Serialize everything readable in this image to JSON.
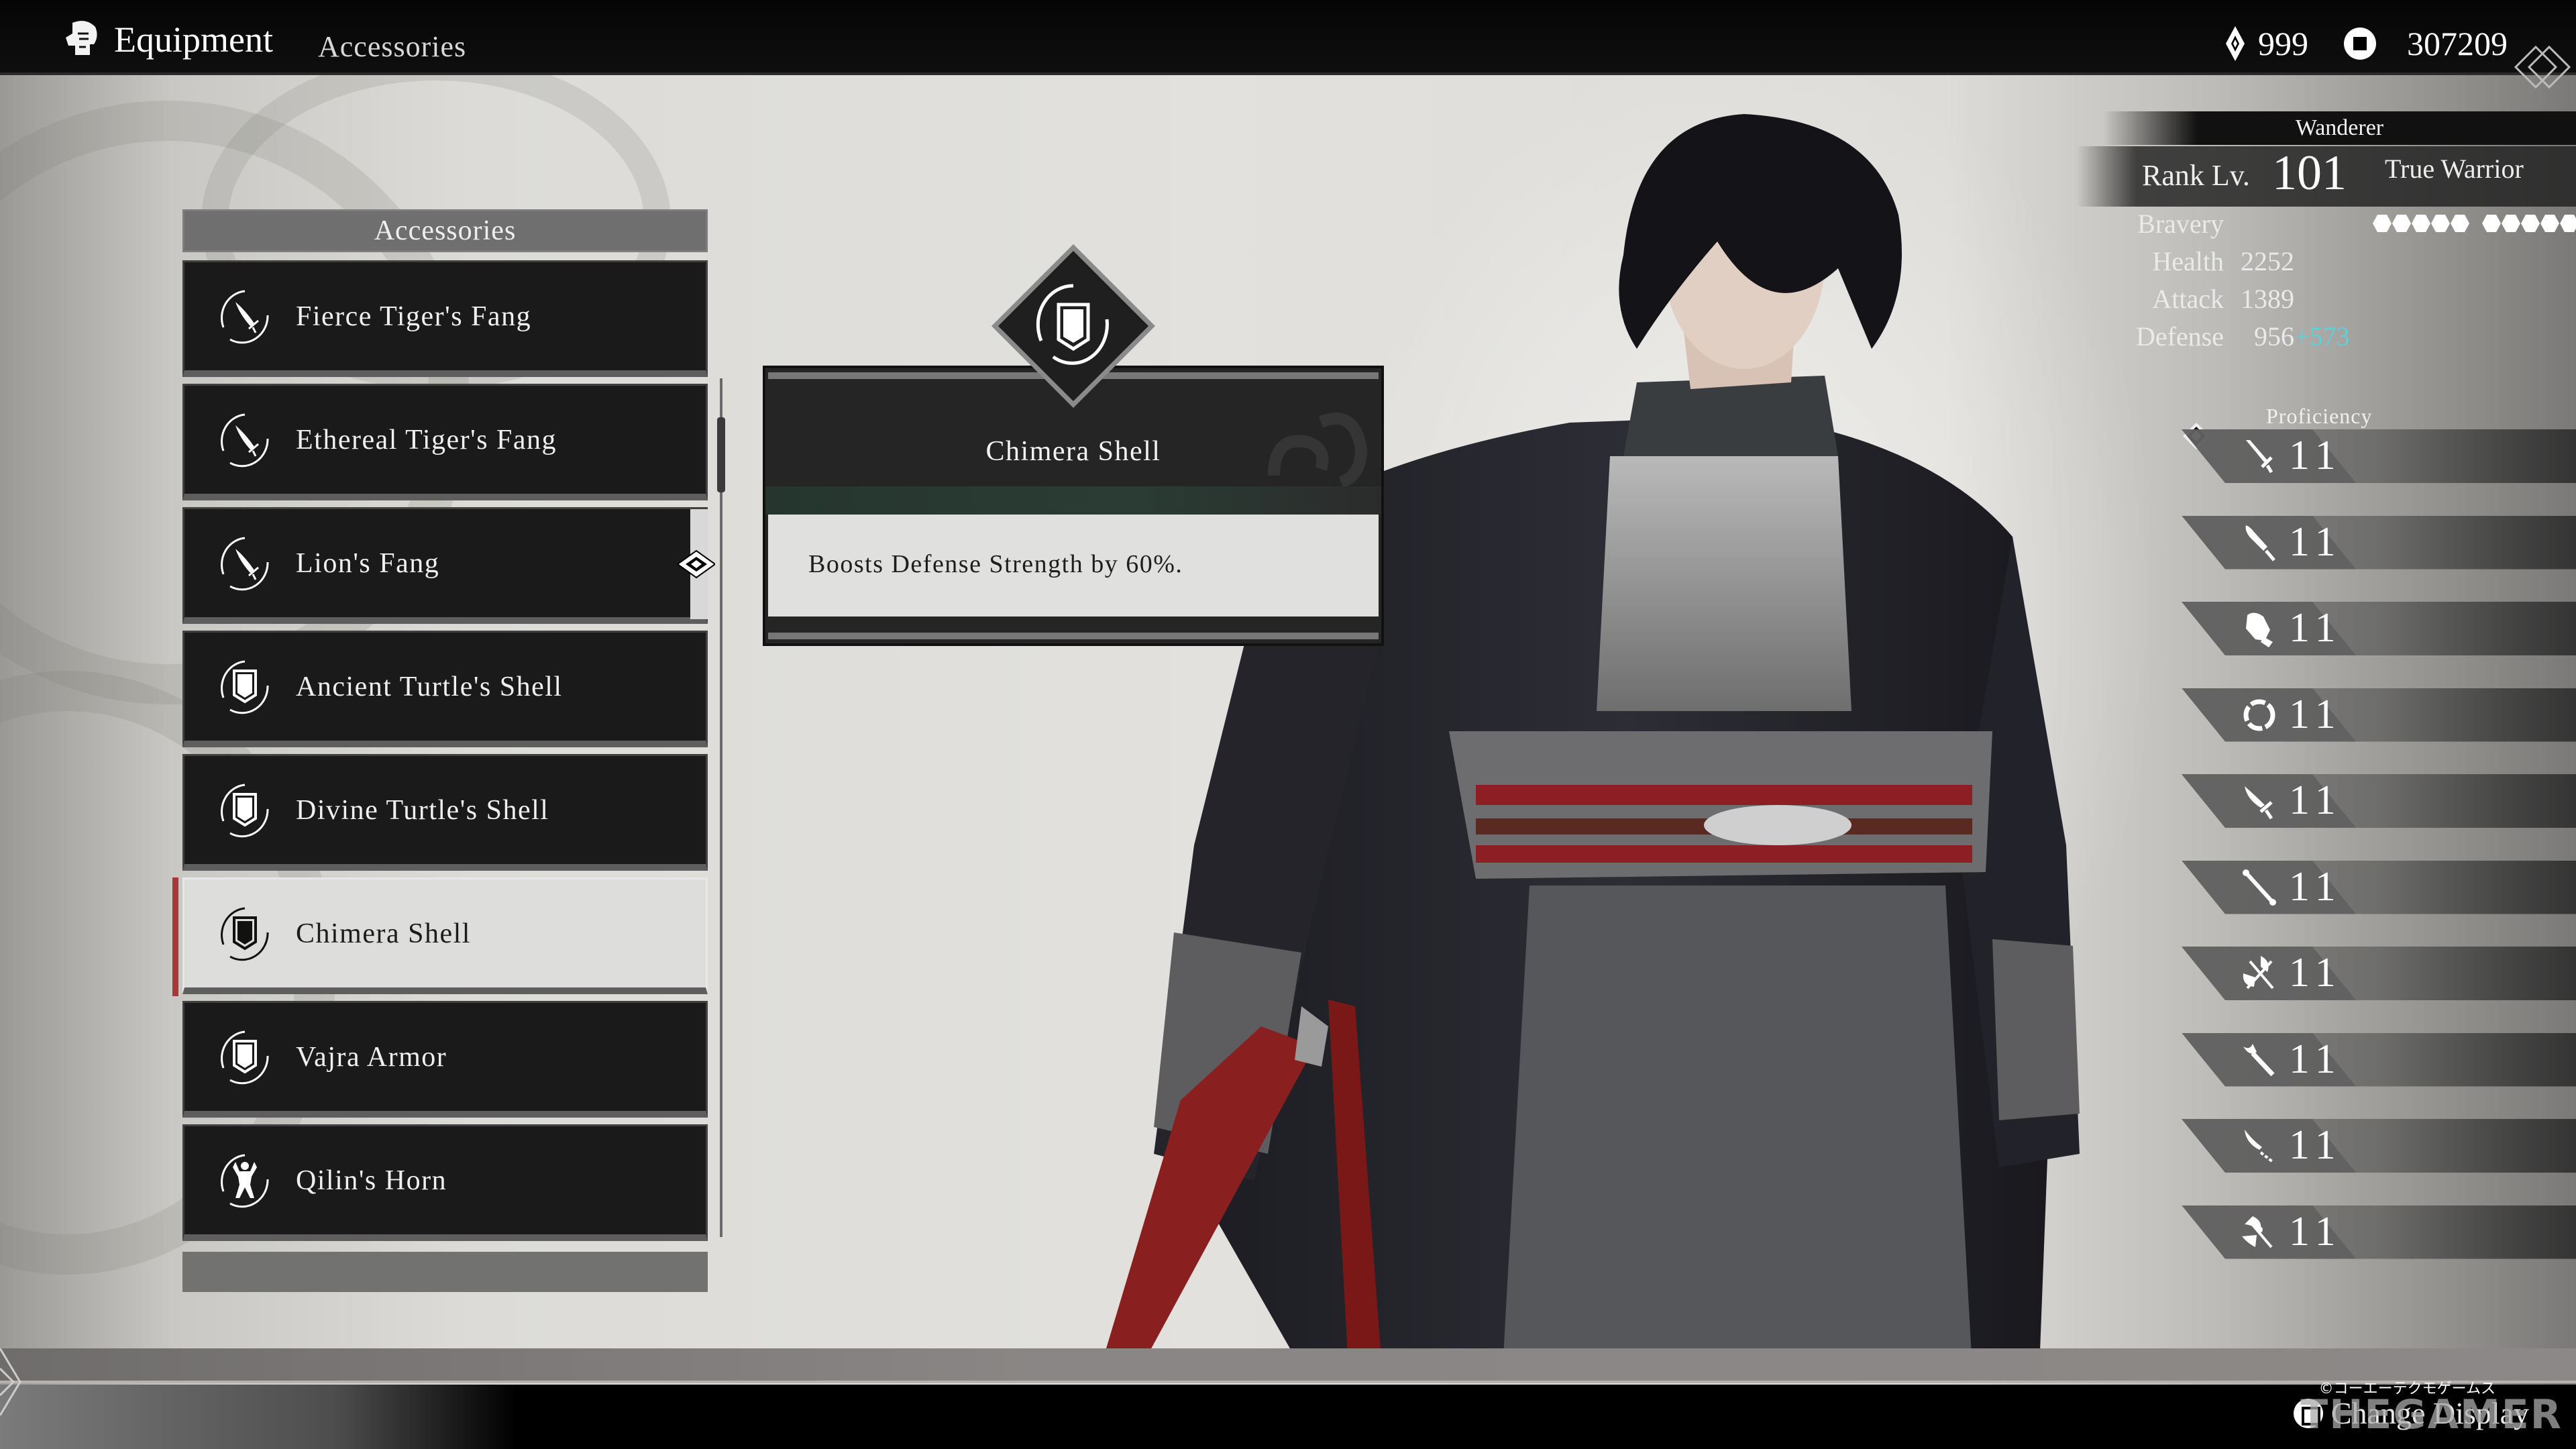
{
  "header": {
    "title": "Equipment",
    "subtitle": "Accessories",
    "icon": "helmet-icon",
    "currencies": [
      {
        "icon": "gem-icon",
        "value": "999"
      },
      {
        "icon": "coin-icon",
        "value": "307209"
      }
    ]
  },
  "list": {
    "title": "Accessories",
    "items": [
      {
        "label": "Fierce Tiger's Fang",
        "icon": "sword-emblem-icon",
        "selected": false,
        "equipped": false
      },
      {
        "label": "Ethereal Tiger's Fang",
        "icon": "sword-emblem-icon",
        "selected": false,
        "equipped": false
      },
      {
        "label": "Lion's Fang",
        "icon": "sword-emblem-icon",
        "selected": false,
        "equipped": true
      },
      {
        "label": "Ancient Turtle's Shell",
        "icon": "shield-emblem-icon",
        "selected": false,
        "equipped": false
      },
      {
        "label": "Divine Turtle's Shell",
        "icon": "shield-emblem-icon",
        "selected": false,
        "equipped": false
      },
      {
        "label": "Chimera Shell",
        "icon": "shield-emblem-icon",
        "selected": true,
        "equipped": false
      },
      {
        "label": "Vajra Armor",
        "icon": "shield-emblem-icon",
        "selected": false,
        "equipped": false
      },
      {
        "label": "Qilin's Horn",
        "icon": "strongman-emblem-icon",
        "selected": false,
        "equipped": false
      }
    ]
  },
  "detail": {
    "name": "Chimera Shell",
    "description": "Boosts Defense Strength by 60%.",
    "icon": "shield-emblem-icon"
  },
  "stats": {
    "name": "Wanderer",
    "rank_label": "Rank Lv.",
    "rank_value": "101",
    "rank_title": "True Warrior",
    "bravery_label": "Bravery",
    "bravery_pips": 10,
    "rows": [
      {
        "label": "Health",
        "value": "2252",
        "bonus": ""
      },
      {
        "label": "Attack",
        "value": "1389",
        "bonus": ""
      },
      {
        "label": "Defense",
        "value": "956",
        "bonus": "+573"
      }
    ],
    "bonus_color": "#5fd0d8"
  },
  "proficiency": {
    "title": "Proficiency",
    "rows": [
      {
        "weapon": "straight-sword-icon",
        "level": "11"
      },
      {
        "weapon": "broad-sword-icon",
        "level": "11"
      },
      {
        "weapon": "gauntlet-icon",
        "level": "11"
      },
      {
        "weapon": "ring-blade-icon",
        "level": "11"
      },
      {
        "weapon": "saber-icon",
        "level": "11"
      },
      {
        "weapon": "staff-icon",
        "level": "11"
      },
      {
        "weapon": "twin-axes-icon",
        "level": "11"
      },
      {
        "weapon": "mace-icon",
        "level": "11"
      },
      {
        "weapon": "glaive-icon",
        "level": "11"
      },
      {
        "weapon": "halberd-icon",
        "level": "11"
      }
    ]
  },
  "footer": {
    "change_display_label": "Change Display",
    "copyright": "©コーエーテクモゲームス",
    "watermark": "THEGAMER"
  },
  "colors": {
    "selection_marker": "#a63a3a",
    "header_bg": "#050505",
    "selected_row_bg": "#dddddc",
    "row_bg": "#1b1a1a"
  }
}
